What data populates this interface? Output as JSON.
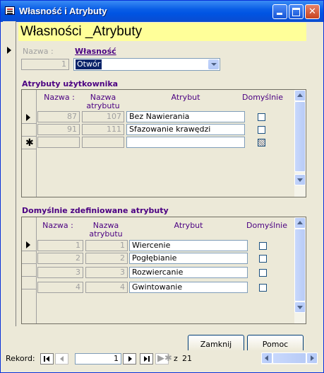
{
  "window": {
    "title": "Własność i Atrybuty"
  },
  "header": {
    "title": "Własności _Atrybuty"
  },
  "main": {
    "nazwa_label": "Nazwa :",
    "nazwa_value": "1",
    "wlasnosc_label": "Własność",
    "wlasnosc_value": "Otwór"
  },
  "user_attrs": {
    "title": "Atrybuty użytkownika",
    "columns": [
      "Nazwa :",
      "Nazwa atrybutu",
      "Atrybut",
      "Domyślnie"
    ],
    "rows": [
      {
        "nazwa": "87",
        "nazwa_atrybutu": "107",
        "atrybut": "Bez Nawierania"
      },
      {
        "nazwa": "91",
        "nazwa_atrybutu": "111",
        "atrybut": "Sfazowanie krawędzi"
      }
    ]
  },
  "default_attrs": {
    "title": "Domyślnie zdefiniowane atrybuty",
    "columns": [
      "Nazwa :",
      "Nazwa atrybutu",
      "Atrybut",
      "Domyślnie"
    ],
    "rows": [
      {
        "nazwa": "1",
        "nazwa_atrybutu": "1",
        "atrybut": "Wiercenie"
      },
      {
        "nazwa": "2",
        "nazwa_atrybutu": "2",
        "atrybut": "Pogłębianie"
      },
      {
        "nazwa": "3",
        "nazwa_atrybutu": "3",
        "atrybut": "Rozwiercanie"
      },
      {
        "nazwa": "4",
        "nazwa_atrybutu": "4",
        "atrybut": "Gwintowanie"
      }
    ]
  },
  "buttons": {
    "close_label": "Zamknij",
    "help_label": "Pomoc"
  },
  "record_nav": {
    "label": "Rekord:",
    "current": "1",
    "of_label": "z",
    "total": "21"
  },
  "icons": {
    "window": "form-icon",
    "minimize": "minimize-icon",
    "maximize": "maximize-icon",
    "close": "close-icon",
    "first": "first-record-icon",
    "prev": "previous-record-icon",
    "next": "next-record-icon",
    "last": "last-record-icon",
    "new": "new-record-icon"
  },
  "colors": {
    "titlebar": "#0054e3",
    "header_bg": "#ffff99",
    "label_purple": "#4b0082"
  }
}
